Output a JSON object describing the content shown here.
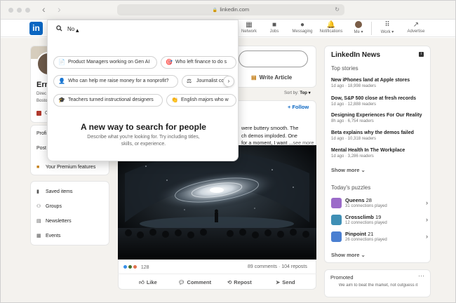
{
  "browser": {
    "url": "linkedin.com",
    "back_icon": "chevron-left-icon",
    "forward_icon": "chevron-right-icon"
  },
  "nav": {
    "logo": "in",
    "items": [
      {
        "label": "Network",
        "icon": "network-icon"
      },
      {
        "label": "Jobs",
        "icon": "briefcase-icon"
      },
      {
        "label": "Messaging",
        "icon": "message-icon"
      },
      {
        "label": "Notifications",
        "icon": "bell-icon"
      },
      {
        "label": "Me ▾",
        "icon": "avatar"
      },
      {
        "label": "Work ▾",
        "icon": "grid-icon"
      },
      {
        "label": "Advertise",
        "icon": "advertise-icon"
      }
    ]
  },
  "search": {
    "value": "No",
    "suggestions": [
      {
        "label": "Product Managers working on Gen AI",
        "icon": "📄"
      },
      {
        "label": "Who left finance to do s",
        "icon": "🎯"
      },
      {
        "label": "Who can help me raise money for a nonprofit?",
        "icon": "👤"
      },
      {
        "label": "Journalist co",
        "icon": "⚖"
      },
      {
        "label": "Teachers turned instructional designers",
        "icon": "🎓"
      },
      {
        "label": "English majors who w",
        "icon": "👏"
      }
    ],
    "promo_heading": "A new way to search for people",
    "promo_desc": "Describe what you're looking for. Try including titles, skills, or experience."
  },
  "profile": {
    "name": "Ern",
    "line1": "Direc",
    "line2": "Bosto",
    "line3": "O"
  },
  "sidebar": {
    "menu1": [
      {
        "label": "Profi"
      },
      {
        "label": "Post"
      }
    ],
    "premium": "Your Premium features",
    "menu2": [
      {
        "label": "Saved items",
        "icon": "bookmark-icon"
      },
      {
        "label": "Groups",
        "icon": "groups-icon"
      },
      {
        "label": "Newsletters",
        "icon": "newsletter-icon"
      },
      {
        "label": "Events",
        "icon": "calendar-icon"
      }
    ]
  },
  "feed": {
    "write_article": "Write Article",
    "sort_label": "Sort by:",
    "sort_value": "Top ▾",
    "follow": "+ Follow",
    "post_text_1": "were buttery smooth. The",
    "post_text_2": "ch demos imploded. One",
    "post_text_3": "for a moment, I want ...",
    "see_more": "see more",
    "reaction_count": "128",
    "stats": "89 comments · 104 reposts",
    "actions": [
      {
        "label": "Like",
        "icon": "thumbs-up-icon"
      },
      {
        "label": "Comment",
        "icon": "comment-icon"
      },
      {
        "label": "Repost",
        "icon": "repost-icon"
      },
      {
        "label": "Send",
        "icon": "send-icon"
      }
    ]
  },
  "news": {
    "title": "LinkedIn News",
    "top_stories_label": "Top stories",
    "stories": [
      {
        "headline": "New iPhones land at Apple stores",
        "readers": "1d ago · 18,998 readers"
      },
      {
        "headline": "Dow, S&P 500 close at fresh records",
        "readers": "1d ago · 12,888 readers"
      },
      {
        "headline": "Designing Experiences For Our Reality",
        "readers": "8h ago · 6,754 readers"
      },
      {
        "headline": "Beta explains why the demos failed",
        "readers": "1d ago · 10,318 readers"
      },
      {
        "headline": "Mental Health In The Workplace",
        "readers": "1d ago · 3,286 readers"
      }
    ],
    "show_more": "Show more",
    "puzzles_label": "Today's puzzles",
    "puzzles": [
      {
        "name": "Queens",
        "number": "28",
        "note": "31 connections played",
        "color": "#9b6bc9"
      },
      {
        "name": "Crossclimb",
        "number": "19",
        "note": "12 connections played",
        "color": "#3f8fb5"
      },
      {
        "name": "Pinpoint",
        "number": "21",
        "note": "26 connections played",
        "color": "#4a7fd1"
      }
    ],
    "show_more_2": "Show more"
  },
  "promoted": {
    "title": "Promoted",
    "desc": "We aim to beat the market, not outguess it"
  }
}
